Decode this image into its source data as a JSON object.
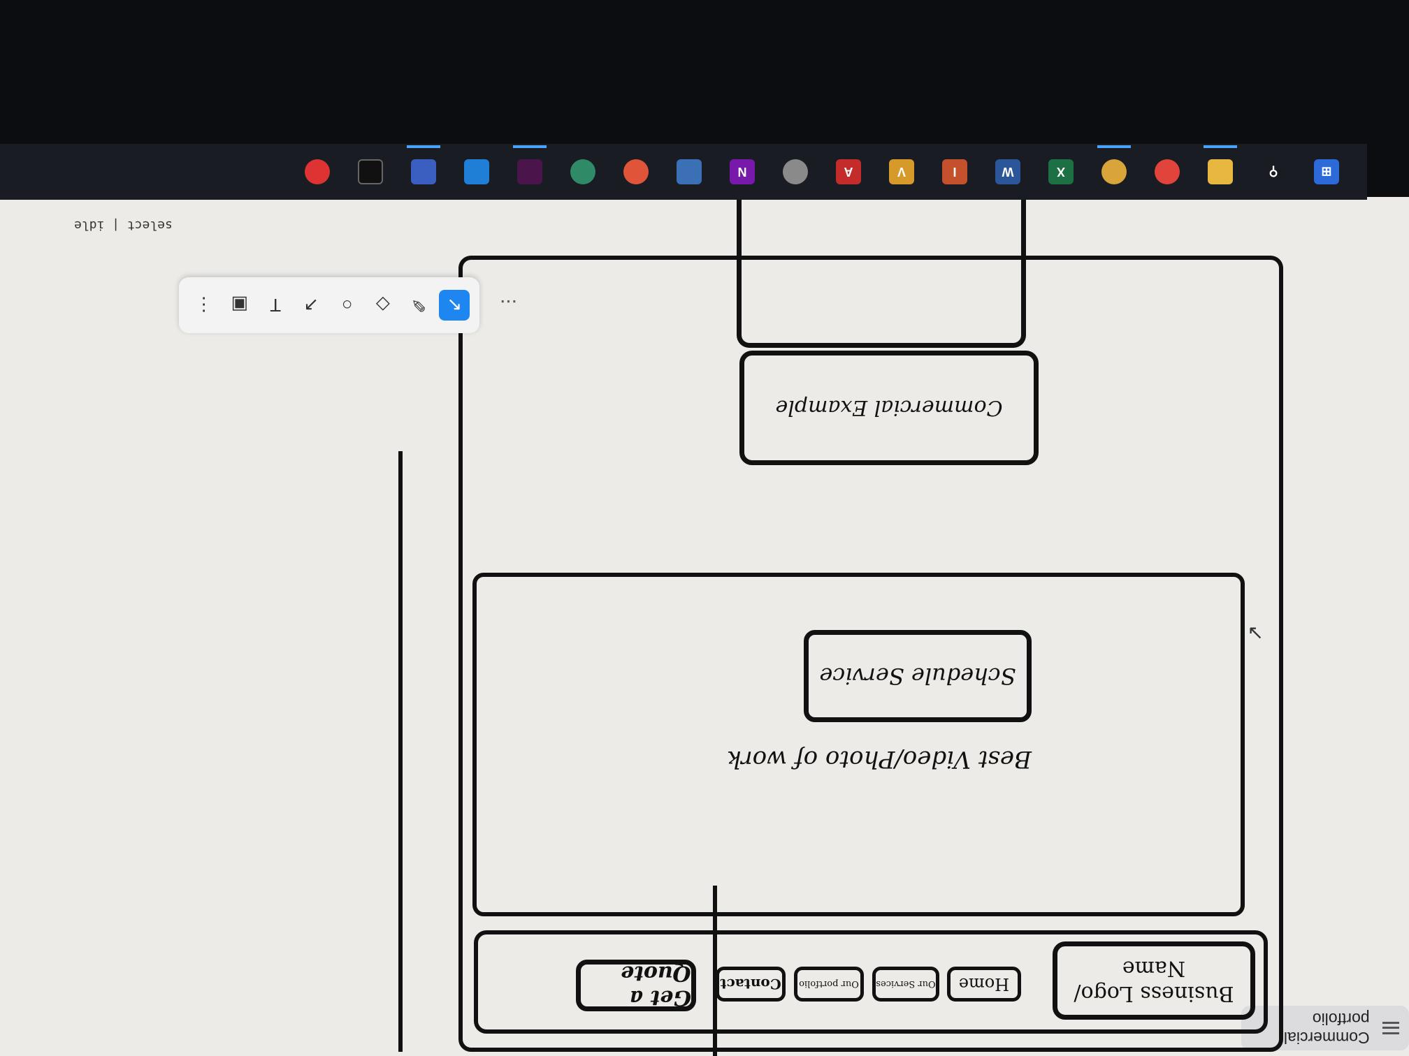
{
  "app": {
    "title": "Commercial portfolio"
  },
  "status": "select | idle",
  "wireframe": {
    "logo": "Business Logo/ Name",
    "nav": [
      "Home",
      "Our Services",
      "Our portfolio",
      "Contact"
    ],
    "cta": "Get a Quote",
    "hero_title": "Best Video/Photo of work",
    "schedule_button": "Schedule Service",
    "commercial_example": "Commercial Example"
  },
  "toolbar": {
    "tools": [
      "select-icon",
      "pencil-icon",
      "eraser-icon",
      "circle-icon",
      "arrow-icon",
      "text-icon",
      "image-icon",
      "more-icon"
    ],
    "more": "..."
  },
  "taskbar": {
    "icons": [
      "windows-icon",
      "search-icon",
      "file-explorer-icon",
      "chrome-icon",
      "chrome-canary-icon",
      "excel-icon",
      "word-icon",
      "powerpoint-icon",
      "visio-icon",
      "acrobat-icon",
      "bug-icon",
      "onenote-icon",
      "window-icon",
      "synology-icon",
      "onbase-icon",
      "slack-icon",
      "vscode-icon",
      "terminal-icon",
      "teams-icon",
      "camera-icon"
    ]
  }
}
